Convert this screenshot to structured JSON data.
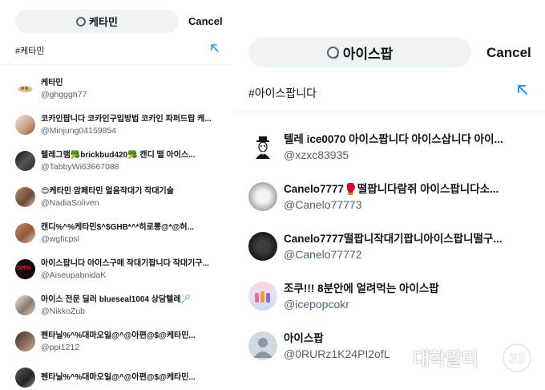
{
  "left": {
    "search": {
      "query": "케타민"
    },
    "cancel_label": "Cancel",
    "hashtag_suggestion": "#케타민",
    "users": [
      {
        "name": "케타민",
        "handle": "@ghgggh77"
      },
      {
        "name": "코카인팝니다 코카인구입방법 코카인 파퍼드랍 케...",
        "handle": "@Minjung04159854"
      },
      {
        "name": "텔레그램🥦brickbud420🥦 캔디 떨 아이스...",
        "handle": "@TabbyWi63667088"
      },
      {
        "name": "😍케타민 암페타민 얼음작대기 작대기술",
        "handle": "@NadiaSoliven"
      },
      {
        "name": "캔디%^%케타민$^$GHB*^*히로뽕@*@허...",
        "handle": "@wgficpsl"
      },
      {
        "name": "아이스팝니다 아이스구매 작대기팝니다 작대기구...",
        "handle": "@AiseupabnidaK"
      },
      {
        "name": "아이스 전문 딜러 blueseal1004 상담텔레🏸",
        "handle": "@NikkoZub"
      },
      {
        "name": "펜타닐%^%대마오일@^@아편@$@케타민...",
        "handle": "@ppi1212"
      },
      {
        "name": "펜타닐%^%대마오일@^@아편@$@케타민...",
        "handle": ""
      }
    ],
    "avatar_text": {
      "open": "OPEN"
    }
  },
  "right": {
    "search": {
      "query": "아이스팝"
    },
    "cancel_label": "Cancel",
    "hashtag_suggestion": "#아이스팝니다",
    "users": [
      {
        "name": "텔레 ice0070 아이스팝니다 아이스삽니다 아이...",
        "handle": "@xzxc83935"
      },
      {
        "name": "Canelo7777🥊떨팝니다람쥐 아이스팝니다소...",
        "handle": "@Canelo77773"
      },
      {
        "name": "Canelo7777떨팝니작대기팝니아이스팝니떨구...",
        "handle": "@Canelo77772"
      },
      {
        "name": "조쿠!!! 8분안에 얼려먹는 아이스팝",
        "handle": "@icepopcokr"
      },
      {
        "name": "아이스팝",
        "handle": "@0RURz1K24PI2ofL"
      }
    ]
  },
  "watermark": {
    "text": "대학알리",
    "logo_text": "33"
  },
  "colors": {
    "accent": "#1d9bf0",
    "search_bg": "#eff3f4",
    "secondary_text": "#536471",
    "primary_text": "#0f1419"
  }
}
